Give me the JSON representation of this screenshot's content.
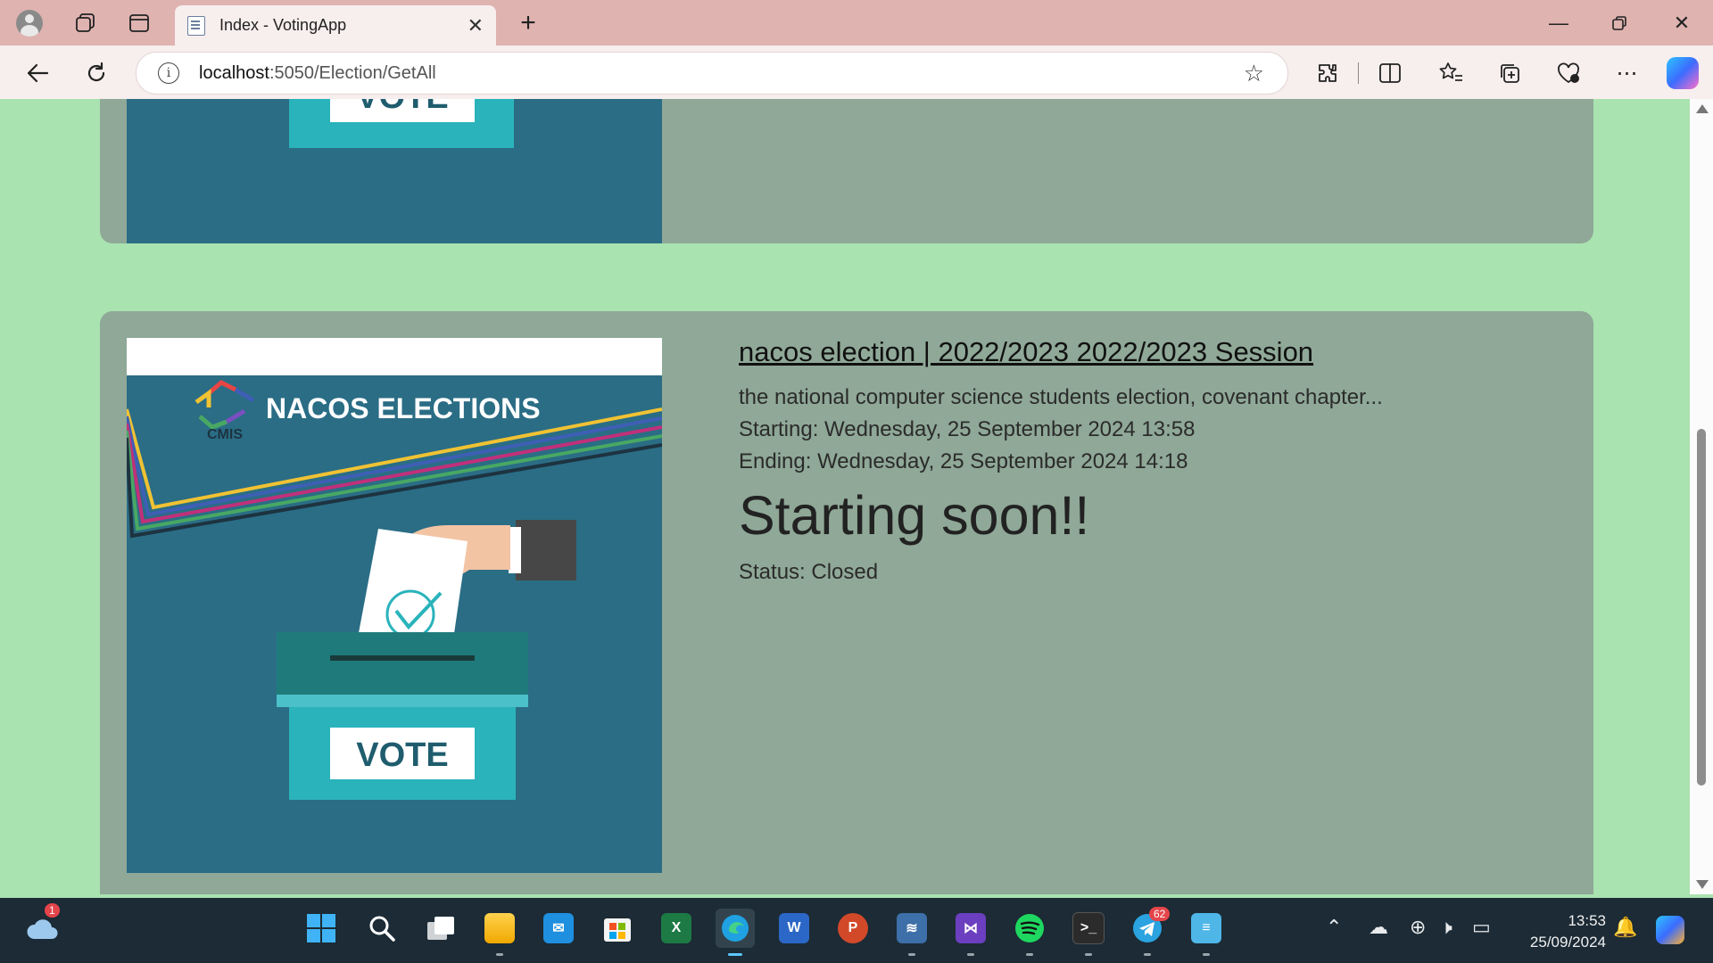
{
  "browser": {
    "tab_title": "Index - VotingApp",
    "url_host": "localhost",
    "url_path": ":5050/Election/GetAll"
  },
  "elections": [
    {
      "title": "nacos election | 2022/2023 2022/2023 Session",
      "description": "the national computer science students election, covenant chapter...",
      "starting": "Starting: Wednesday, 25 September 2024 13:58",
      "ending": "Ending: Wednesday, 25 September 2024 14:18",
      "countdown": "Starting soon!!",
      "status": "Status: Closed",
      "poster": {
        "heading": "NACOS ELECTIONS",
        "org": "CMIS",
        "box_label": "VOTE"
      }
    }
  ],
  "previous_card": {
    "poster_box_label": "VOTE"
  },
  "taskbar": {
    "weather_badge": "1",
    "telegram_badge": "62",
    "time": "13:53",
    "date": "25/09/2024"
  },
  "colors": {
    "page_bg": "#a9e3b0",
    "card_bg": "#8fa897",
    "poster_bg": "#2a6d85",
    "tab_strip": "#dfb3b0"
  }
}
